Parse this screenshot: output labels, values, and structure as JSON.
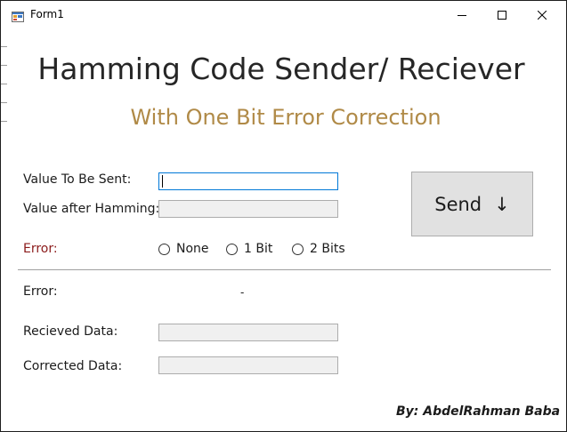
{
  "window": {
    "title": "Form1",
    "icon": "winforms-app-icon"
  },
  "header": {
    "title": "Hamming Code Sender/ Reciever",
    "subtitle": "With One Bit Error Correction",
    "subtitle_color": "#b08a47"
  },
  "sender": {
    "value_label": "Value To Be Sent:",
    "value_input": "",
    "hamming_label": "Value after Hamming:",
    "hamming_value": ""
  },
  "send_button": {
    "label": "Send",
    "arrow": "↓",
    "icon": "down-arrow-icon"
  },
  "error_options": {
    "label": "Error:",
    "label_color": "#8b1a1a",
    "options": [
      {
        "label": "None",
        "selected": false
      },
      {
        "label": "1 Bit",
        "selected": false
      },
      {
        "label": "2 Bits",
        "selected": false
      }
    ]
  },
  "receiver": {
    "error_label": "Error:",
    "error_value": "-",
    "received_label": "Recieved Data:",
    "received_value": "",
    "corrected_label": "Corrected Data:",
    "corrected_value": ""
  },
  "footer": {
    "author": "By: AbdelRahman Baba"
  }
}
